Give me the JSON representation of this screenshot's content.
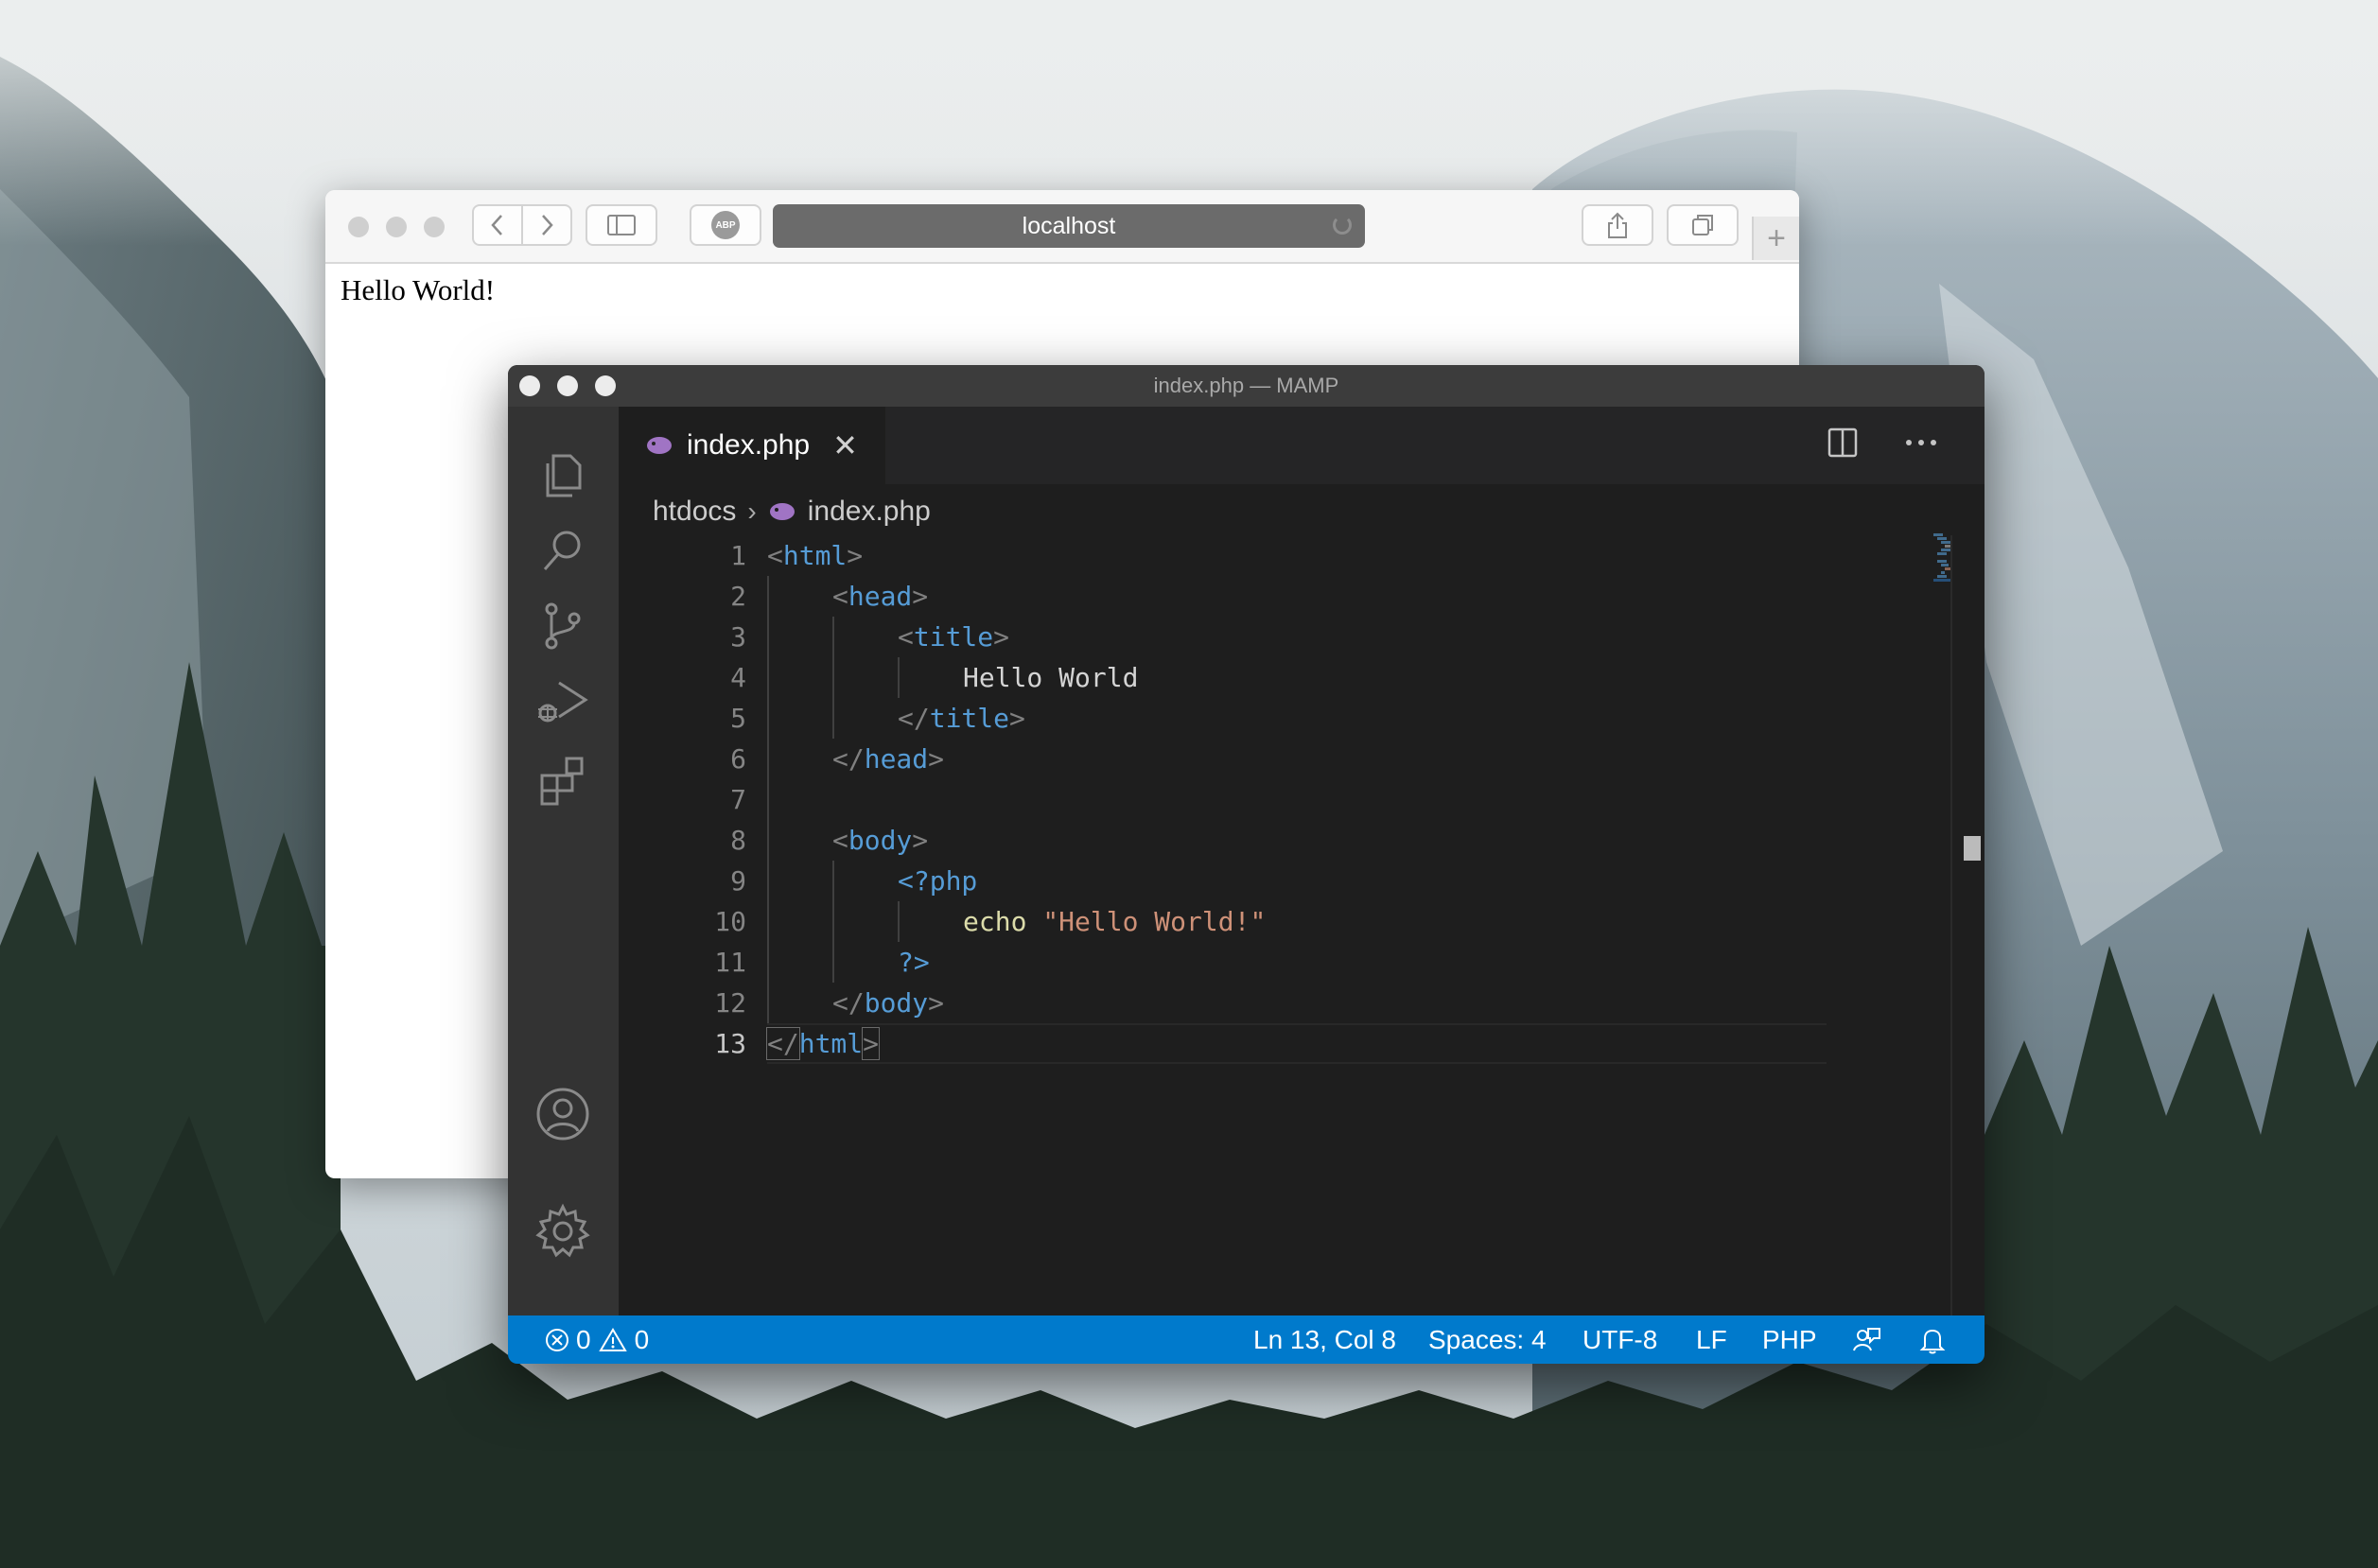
{
  "safari": {
    "address": "localhost",
    "adblock_label": "ABP",
    "page_text": "Hello World!"
  },
  "vscode": {
    "window_title": "index.php — MAMP",
    "tab": {
      "label": "index.php",
      "close": "✕"
    },
    "breadcrumb": {
      "folder": "htdocs",
      "file": "index.php"
    },
    "line_numbers": [
      "1",
      "2",
      "3",
      "4",
      "5",
      "6",
      "7",
      "8",
      "9",
      "10",
      "11",
      "12",
      "13"
    ],
    "code": {
      "l1_open": "<",
      "l1_tag": "html",
      "l1_close": ">",
      "l2_open": "<",
      "l2_tag": "head",
      "l2_close": ">",
      "l3_open": "<",
      "l3_tag": "title",
      "l3_close": ">",
      "l4_text": "Hello World",
      "l5_open": "</",
      "l5_tag": "title",
      "l5_close": ">",
      "l6_open": "</",
      "l6_tag": "head",
      "l6_close": ">",
      "l8_open": "<",
      "l8_tag": "body",
      "l8_close": ">",
      "l9_php": "<?php",
      "l10_kw": "echo",
      "l10_str": "\"Hello World!\"",
      "l11_php": "?>",
      "l12_open": "</",
      "l12_tag": "body",
      "l12_close": ">",
      "l13_open": "</",
      "l13_tag": "html",
      "l13_close": ">"
    },
    "status": {
      "errors": "0",
      "warnings": "0",
      "position": "Ln 13, Col 8",
      "spaces": "Spaces: 4",
      "encoding": "UTF-8",
      "eol": "LF",
      "language": "PHP"
    },
    "colors": {
      "statusbar": "#007acc",
      "tag": "#569cd6",
      "string": "#ce9178",
      "keyword": "#dcdcaa"
    }
  }
}
